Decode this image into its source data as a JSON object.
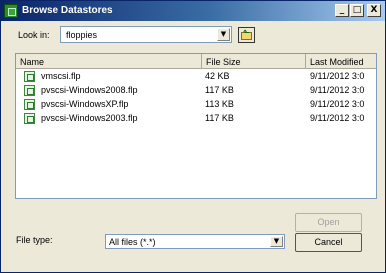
{
  "window": {
    "title": "Browse Datastores"
  },
  "titlebar_buttons": {
    "minimize": "_",
    "maximize": "□",
    "close": "X"
  },
  "lookin": {
    "label": "Look in:",
    "value": "floppies",
    "up_icon": "up-folder-icon"
  },
  "columns": {
    "name": "Name",
    "size": "File Size",
    "modified": "Last Modified"
  },
  "files": [
    {
      "name": "vmscsi.flp",
      "size": "42 KB",
      "modified": "9/11/2012 3:0"
    },
    {
      "name": "pvscsi-Windows2008.flp",
      "size": "117 KB",
      "modified": "9/11/2012 3:0"
    },
    {
      "name": "pvscsi-WindowsXP.flp",
      "size": "113 KB",
      "modified": "9/11/2012 3:0"
    },
    {
      "name": "pvscsi-Windows2003.flp",
      "size": "117 KB",
      "modified": "9/11/2012 3:0"
    }
  ],
  "filetype": {
    "label": "File type:",
    "value": "All files (*.*)"
  },
  "buttons": {
    "open": "Open",
    "cancel": "Cancel"
  },
  "colors": {
    "titlebar_start": "#0a246a",
    "dialog_bg": "#ece9d8",
    "file_icon": "#3a8a3a"
  },
  "icons": {
    "app": "vsphere-app-icon",
    "file": "floppy-file-icon"
  }
}
